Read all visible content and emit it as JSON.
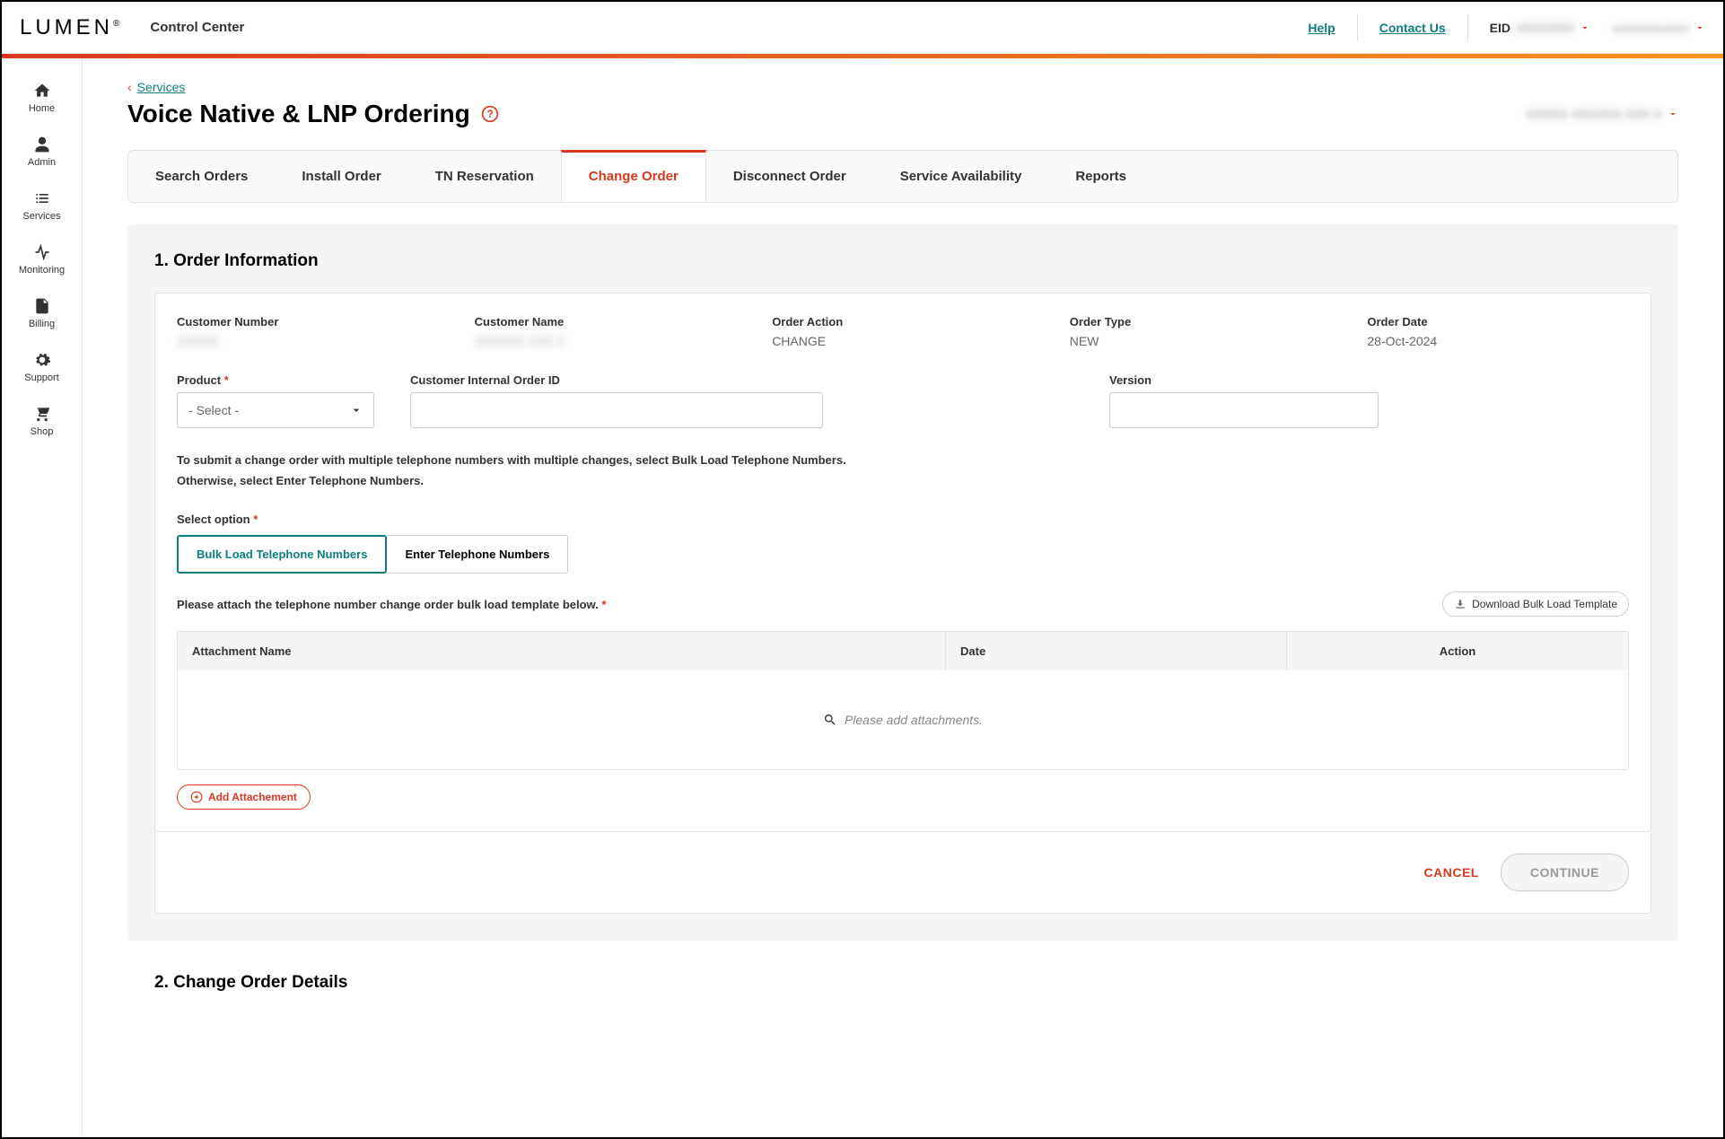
{
  "header": {
    "logo": "LUMEN",
    "title": "Control Center",
    "help_link": "Help",
    "contact_link": "Contact Us",
    "eid_label": "EID"
  },
  "sidebar": {
    "items": [
      {
        "label": "Home"
      },
      {
        "label": "Admin"
      },
      {
        "label": "Services"
      },
      {
        "label": "Monitoring"
      },
      {
        "label": "Billing"
      },
      {
        "label": "Support"
      },
      {
        "label": "Shop"
      }
    ]
  },
  "breadcrumb": {
    "services": "Services"
  },
  "page_title": "Voice Native & LNP Ordering",
  "tabs": [
    {
      "label": "Search Orders"
    },
    {
      "label": "Install Order"
    },
    {
      "label": "TN Reservation"
    },
    {
      "label": "Change Order"
    },
    {
      "label": "Disconnect Order"
    },
    {
      "label": "Service Availability"
    },
    {
      "label": "Reports"
    }
  ],
  "section1": {
    "title": "1. Order Information",
    "fields": {
      "customer_number_label": "Customer Number",
      "customer_name_label": "Customer Name",
      "order_action_label": "Order Action",
      "order_action_value": "CHANGE",
      "order_type_label": "Order Type",
      "order_type_value": "NEW",
      "order_date_label": "Order Date",
      "order_date_value": "28-Oct-2024",
      "product_label": "Product",
      "product_placeholder": "- Select -",
      "internal_order_label": "Customer Internal Order ID",
      "version_label": "Version"
    },
    "info1": "To submit a change order with multiple telephone numbers with multiple changes, select Bulk Load Telephone Numbers.",
    "info2": "Otherwise, select Enter Telephone Numbers.",
    "select_option_label": "Select option",
    "option_bulk": "Bulk Load Telephone Numbers",
    "option_enter": "Enter Telephone Numbers",
    "attach_label": "Please attach the telephone number change order bulk load template below.",
    "download_label": "Download Bulk Load Template",
    "table": {
      "col_name": "Attachment Name",
      "col_date": "Date",
      "col_action": "Action",
      "empty": "Please add attachments."
    },
    "add_attachment": "Add Attachement",
    "cancel": "CANCEL",
    "continue": "CONTINUE"
  },
  "section2": {
    "title": "2. Change Order Details"
  }
}
